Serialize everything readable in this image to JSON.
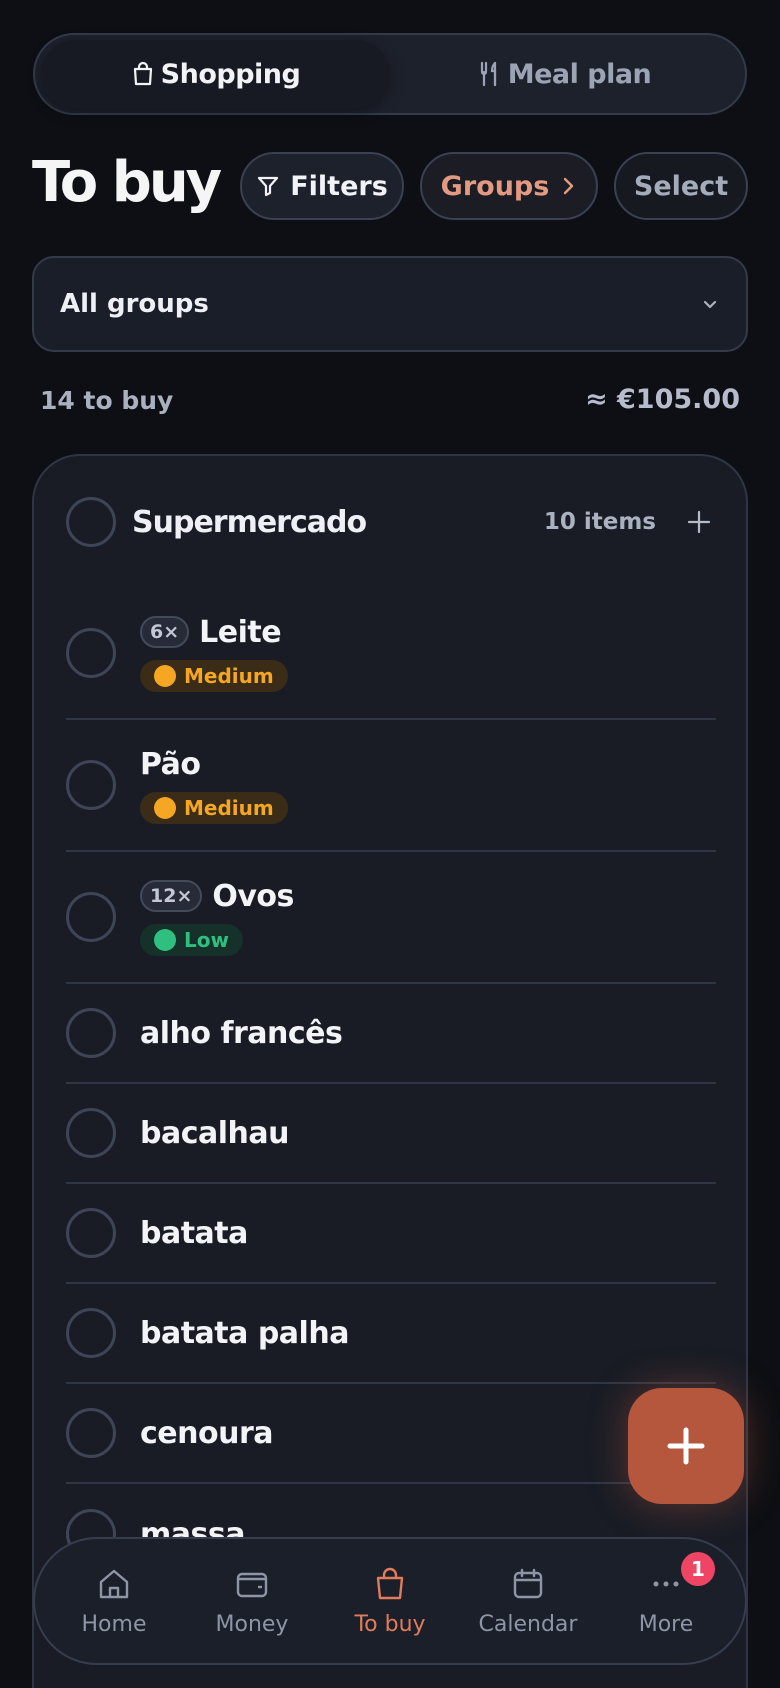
{
  "tabs": {
    "shopping": {
      "label": "Shopping",
      "icon": "bag-icon"
    },
    "meal_plan": {
      "label": "Meal plan",
      "icon": "utensils-icon"
    }
  },
  "header": {
    "title": "To buy",
    "filters_label": "Filters",
    "groups_label": "Groups",
    "select_label": "Select"
  },
  "group_filter": {
    "value": "All groups"
  },
  "summary": {
    "count": "14 to buy",
    "total": "≈ €105.00"
  },
  "group": {
    "name": "Supermercado",
    "count": "10 items",
    "items": [
      {
        "qty": "6×",
        "name": "Leite",
        "priority": "Medium"
      },
      {
        "qty": "",
        "name": "Pão",
        "priority": "Medium"
      },
      {
        "qty": "12×",
        "name": "Ovos",
        "priority": "Low"
      },
      {
        "qty": "",
        "name": "alho francês",
        "priority": ""
      },
      {
        "qty": "",
        "name": "bacalhau",
        "priority": ""
      },
      {
        "qty": "",
        "name": "batata",
        "priority": ""
      },
      {
        "qty": "",
        "name": "batata palha",
        "priority": ""
      },
      {
        "qty": "",
        "name": "cenoura",
        "priority": ""
      },
      {
        "qty": "",
        "name": "massa",
        "priority": ""
      }
    ]
  },
  "nav": {
    "home": "Home",
    "money": "Money",
    "to_buy": "To buy",
    "calendar": "Calendar",
    "more": "More",
    "more_badge": "1"
  },
  "colors": {
    "accent": "#e07b5b",
    "fab": "#b5573c",
    "medium": "#f5a623",
    "low": "#2fbf7f",
    "badge": "#ee4565"
  }
}
